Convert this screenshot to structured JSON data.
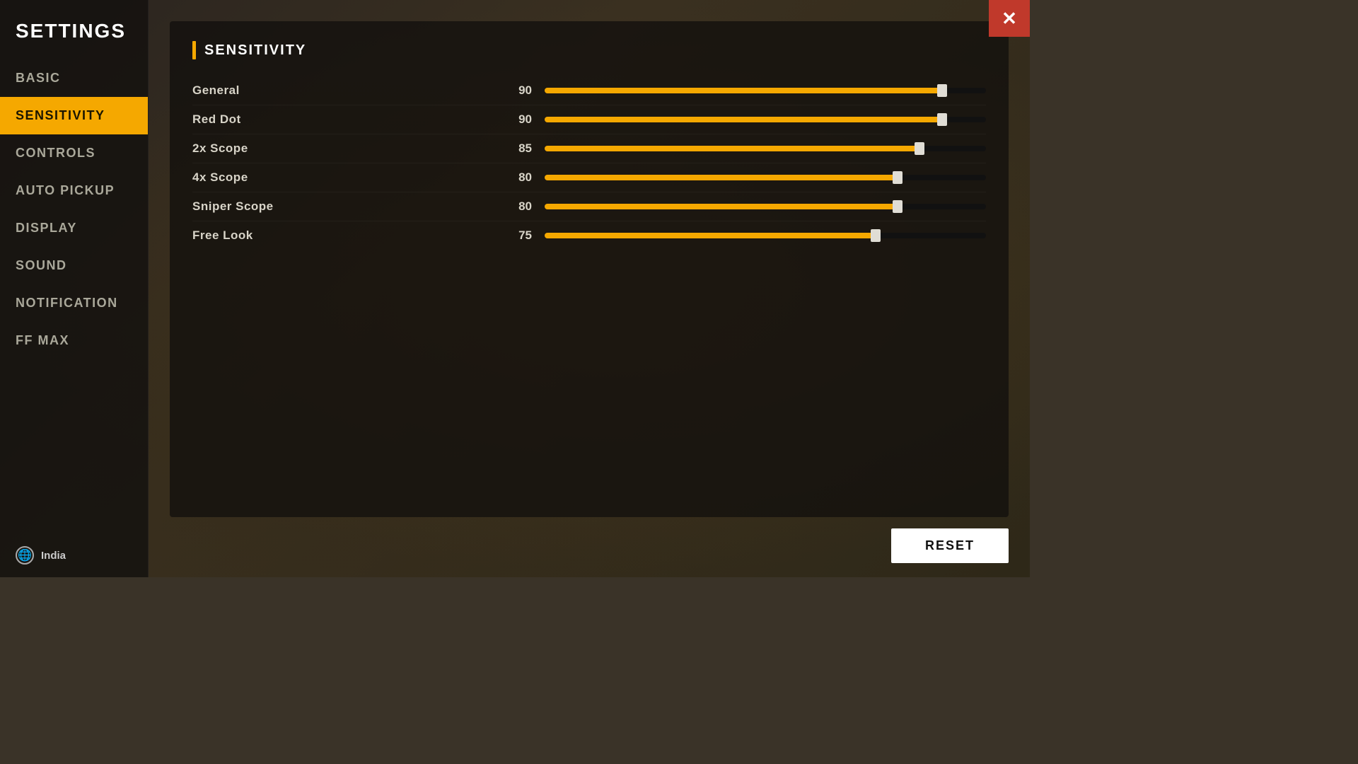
{
  "app": {
    "title": "SETTINGS"
  },
  "sidebar": {
    "items": [
      {
        "id": "basic",
        "label": "BASIC",
        "active": false
      },
      {
        "id": "sensitivity",
        "label": "SENSITIVITY",
        "active": true
      },
      {
        "id": "controls",
        "label": "CONTROLS",
        "active": false
      },
      {
        "id": "auto-pickup",
        "label": "AUTO PICKUP",
        "active": false
      },
      {
        "id": "display",
        "label": "DISPLAY",
        "active": false
      },
      {
        "id": "sound",
        "label": "SOUND",
        "active": false
      },
      {
        "id": "notification",
        "label": "NOTIFICATION",
        "active": false
      },
      {
        "id": "ff-max",
        "label": "FF MAX",
        "active": false
      }
    ],
    "footer": {
      "region": "India"
    }
  },
  "content": {
    "section_title": "SENSITIVITY",
    "sliders": [
      {
        "label": "General",
        "value": 90,
        "max": 100,
        "pct": 90
      },
      {
        "label": "Red Dot",
        "value": 90,
        "max": 100,
        "pct": 90
      },
      {
        "label": "2x Scope",
        "value": 85,
        "max": 100,
        "pct": 85
      },
      {
        "label": "4x Scope",
        "value": 80,
        "max": 100,
        "pct": 80
      },
      {
        "label": "Sniper Scope",
        "value": 80,
        "max": 100,
        "pct": 80
      },
      {
        "label": "Free Look",
        "value": 75,
        "max": 100,
        "pct": 75
      }
    ]
  },
  "actions": {
    "reset_label": "RESET",
    "close_icon": "✕"
  }
}
